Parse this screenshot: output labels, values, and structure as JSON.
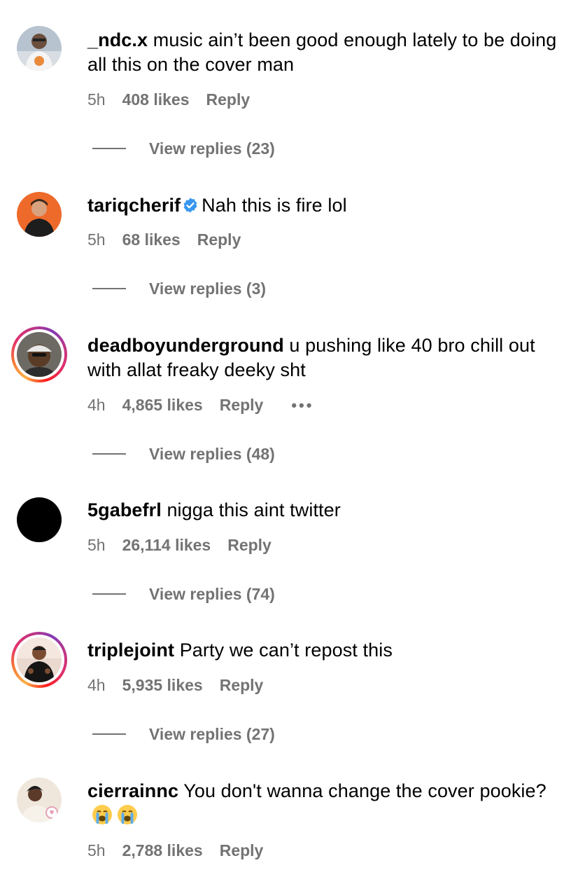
{
  "comments": [
    {
      "username": "_ndc.x",
      "text": " music ain’t been good enough lately to be doing all this on the cover man",
      "time": "5h",
      "likes": "408 likes",
      "reply": "Reply",
      "view_replies": "View replies (23)"
    },
    {
      "username": "tariqcherif",
      "text": "Nah this is fire lol",
      "time": "5h",
      "likes": "68 likes",
      "reply": "Reply",
      "view_replies": "View replies (3)"
    },
    {
      "username": "deadboyunderground",
      "text": " u pushing like 40 bro chill out with allat freaky deeky sht",
      "time": "4h",
      "likes": "4,865 likes",
      "reply": "Reply",
      "more": "•••",
      "view_replies": "View replies (48)"
    },
    {
      "username": "5gabefrl",
      "text": " nigga this aint twitter",
      "time": "5h",
      "likes": "26,114 likes",
      "reply": "Reply",
      "view_replies": "View replies (74)"
    },
    {
      "username": "triplejoint",
      "text": " Party we can’t repost this",
      "time": "4h",
      "likes": "5,935 likes",
      "reply": "Reply",
      "view_replies": "View replies (27)"
    },
    {
      "username": "cierrainnc",
      "text": " You don't wanna change the cover pookie?",
      "time": "5h",
      "likes": "2,788 likes",
      "reply": "Reply"
    }
  ],
  "colors": {
    "meta_gray": "#737373",
    "verified_blue": "#3897f0"
  },
  "icons": {
    "verified": "verified-badge-icon",
    "crying_emoji": "loudly-crying-face-icon"
  }
}
